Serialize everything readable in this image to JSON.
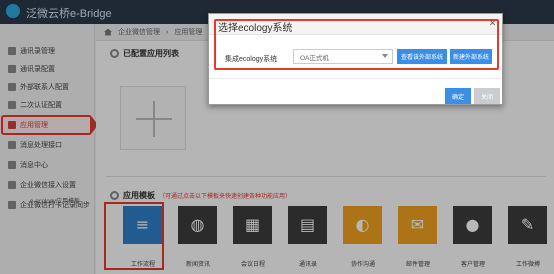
{
  "header": {
    "app_title": "泛微云桥e-Bridge"
  },
  "sidebar": {
    "items": [
      {
        "label": "通讯录管理",
        "icon": "contacts-icon"
      },
      {
        "label": "通讯录配置",
        "icon": "contacts-config-icon"
      },
      {
        "label": "外部联系人配置",
        "icon": "external-contact-icon"
      },
      {
        "label": "二次认证配置",
        "icon": "auth-icon"
      },
      {
        "label": "应用管理",
        "icon": "app-management-icon",
        "active": true
      },
      {
        "label": "消息处理接口",
        "icon": "message-interface-icon"
      },
      {
        "label": "消息中心",
        "icon": "message-center-icon"
      },
      {
        "label": "企业微信接入设置",
        "icon": "wechat-access-icon"
      },
      {
        "label": "企业微信打卡记录同步",
        "icon": "checkin-sync-icon"
      }
    ]
  },
  "breadcrumb": {
    "items": [
      "企业微信管理",
      "应用管理"
    ]
  },
  "main": {
    "configured_title": "已配置应用列表",
    "templates_title": "应用模板",
    "templates_note": "（可通过点击以下模板来快速创建各种功能应用）",
    "templates_sub": "e-ecology应用模板",
    "tiles": [
      {
        "label": "工作流程",
        "icon": "layers-icon",
        "color": "#2f7fc8"
      },
      {
        "label": "新闻资讯",
        "icon": "globe-icon",
        "color": "#3c3c3c"
      },
      {
        "label": "会议日程",
        "icon": "calendar-icon",
        "color": "#3c3c3c"
      },
      {
        "label": "通讯录",
        "icon": "address-book-icon",
        "color": "#3c3c3c"
      },
      {
        "label": "协作沟通",
        "icon": "chat-icon",
        "color": "#f0a020"
      },
      {
        "label": "邮件管理",
        "icon": "mail-icon",
        "color": "#f0a020"
      },
      {
        "label": "客户管理",
        "icon": "customer-icon",
        "color": "#3c3c3c"
      },
      {
        "label": "工作微搏",
        "icon": "edit-icon",
        "color": "#3c3c3c"
      }
    ]
  },
  "modal": {
    "title": "选择ecology系统",
    "field_label": "集成ecology系统",
    "select_value": "OA正式机",
    "view_button": "查看该外部系统",
    "new_button": "新建外部系统",
    "ok_button": "确定",
    "close_button": "关闭"
  }
}
